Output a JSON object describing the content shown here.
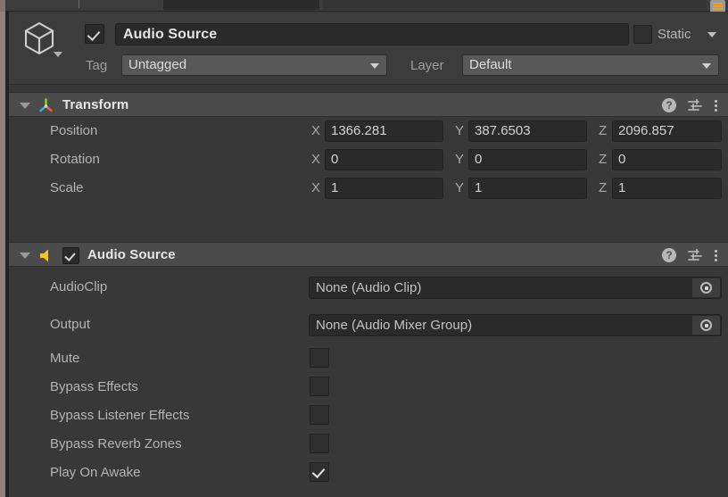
{
  "window": {
    "lock_icon": "inspector-lock-icon"
  },
  "game_object": {
    "enabled": true,
    "name": "Audio Source",
    "icon": "cube-prefab-icon",
    "static_label": "Static",
    "static_checked": false,
    "tag_label": "Tag",
    "tag_value": "Untagged",
    "layer_label": "Layer",
    "layer_value": "Default"
  },
  "header_icons": {
    "help": "?",
    "help_name": "help-icon",
    "preset_name": "preset-settings-icon",
    "kebab_name": "more-options-icon"
  },
  "components": [
    {
      "name": "Transform",
      "icon": "transform-gizmo-icon",
      "has_enable_toggle": false,
      "axes": [
        "X",
        "Y",
        "Z"
      ],
      "rows": [
        {
          "label": "Position",
          "values": [
            "1366.281",
            "387.6503",
            "2096.857"
          ]
        },
        {
          "label": "Rotation",
          "values": [
            "0",
            "0",
            "0"
          ]
        },
        {
          "label": "Scale",
          "values": [
            "1",
            "1",
            "1"
          ]
        }
      ]
    },
    {
      "name": "Audio Source",
      "icon": "speaker-icon",
      "has_enable_toggle": true,
      "enabled": true,
      "object_rows": [
        {
          "label": "AudioClip",
          "value": "None (Audio Clip)"
        },
        {
          "label": "Output",
          "value": "None (Audio Mixer Group)"
        }
      ],
      "toggle_rows": [
        {
          "label": "Mute",
          "checked": false
        },
        {
          "label": "Bypass Effects",
          "checked": false
        },
        {
          "label": "Bypass Listener Effects",
          "checked": false
        },
        {
          "label": "Bypass Reverb Zones",
          "checked": false
        },
        {
          "label": "Play On Awake",
          "checked": true
        }
      ]
    }
  ],
  "colors": {
    "panel_bg": "#383838",
    "header_bg": "#4b4b4b",
    "field_bg": "#2a2a2a",
    "accent_orange": "#f0a019",
    "speaker_yellow": "#f5c518",
    "text": "#b4b4b4"
  }
}
